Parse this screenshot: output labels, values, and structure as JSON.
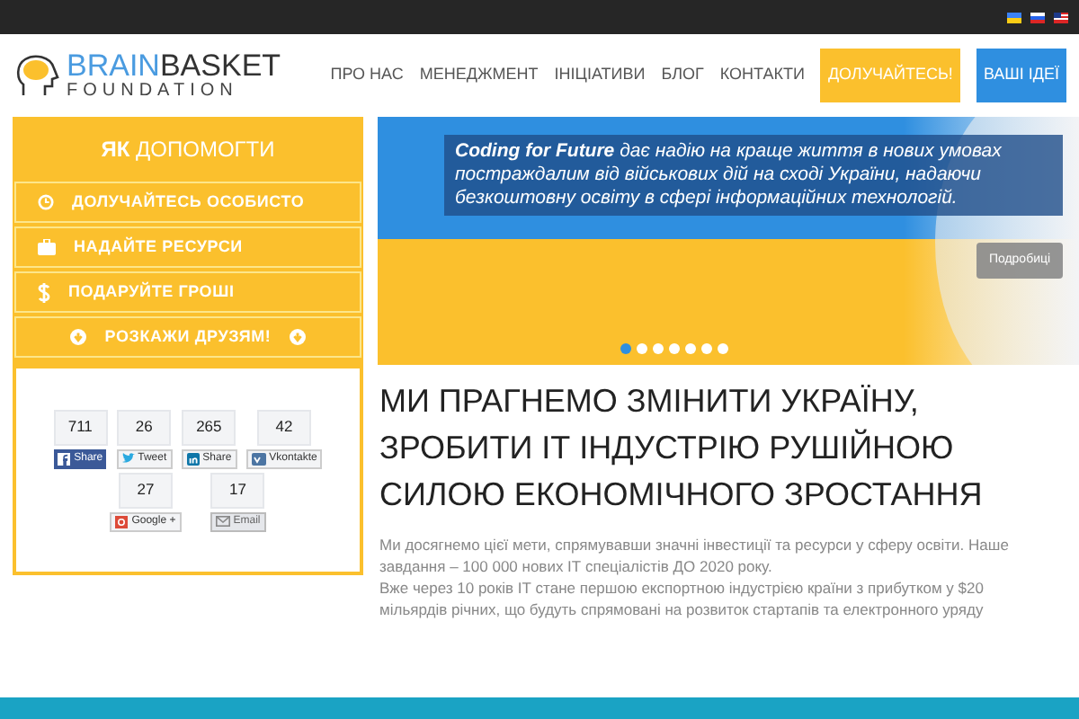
{
  "logo": {
    "first": "BRAIN",
    "second": "BASKET",
    "subtitle": "FOUNDATION"
  },
  "nav": [
    {
      "label": "ПРО НАС",
      "kind": "link"
    },
    {
      "label": "МЕНЕДЖМЕНТ",
      "kind": "link"
    },
    {
      "label": "ІНІЦІАТИВИ",
      "kind": "link"
    },
    {
      "label": "БЛОГ",
      "kind": "link"
    },
    {
      "label": "КОНТАКТИ",
      "kind": "link"
    },
    {
      "label": "ДОЛУЧАЙТЕСЬ!",
      "kind": "button",
      "color": "#fbc02d"
    },
    {
      "label": "ВАШІ ІДЕЇ",
      "kind": "button",
      "color": "#2f8fe0"
    }
  ],
  "help_panel": {
    "title": "**ЯК** ДОПОМОГТИ",
    "items": [
      {
        "label": "ДОЛУЧАЙТЕСЬ ОСОБИСТО",
        "kind": "clock"
      },
      {
        "label": "НАДАЙТЕ РЕСУРСИ",
        "kind": "briefcase"
      },
      {
        "label": "ПОДАРУЙТЕ ГРОШІ",
        "kind": "dollar"
      },
      {
        "label": "РОЗКАЖИ ДРУЗЯМ!",
        "kind": "share"
      }
    ]
  },
  "share_buttons": [
    {
      "count": "711",
      "label": "Share",
      "kind": "facebook"
    },
    {
      "count": "26",
      "label": "Tweet",
      "kind": "twitter"
    },
    {
      "count": "265",
      "label": "Share",
      "kind": "linkedin"
    },
    {
      "count": "42",
      "label": "Vkontakte",
      "kind": "vk"
    },
    {
      "count": "27",
      "label": "Google +",
      "kind": "google"
    },
    {
      "count": "17",
      "label": "Email",
      "kind": "email"
    }
  ],
  "slider": {
    "caption": "**Coding for Future** дає надію на краще життя в нових умовах постраждалим від військових дій на сході України, надаючи безкоштовну освіту в сфері інформаційних технологій.",
    "button": "Подробиці",
    "dots": [
      {
        "selected": true
      },
      {
        "selected": false
      },
      {
        "selected": false
      },
      {
        "selected": false
      },
      {
        "selected": false
      },
      {
        "selected": false
      },
      {
        "selected": false
      }
    ]
  },
  "mission": {
    "heading": "МИ ПРАГНЕМО ЗМІНИТИ УКРАЇНУ, ЗРОБИТИ ІТ ІНДУСТРІЮ РУШІЙНОЮ СИЛОЮ ЕКОНОМІЧНОГО ЗРОСТАННЯ",
    "paragraphs": [
      "Ми досягнемо цієї мети, спрямувавши значні інвестиції та ресурси у сферу освіти. Наше завдання – 100 000 нових ІТ спеціалістів ДО 2020 року.",
      "Вже через 10 років ІТ стане першою експортною індустрією країни з прибутком у $20 мільярдів річних, що будуть спрямовані на розвиток стартапів та електронного уряду"
    ]
  }
}
